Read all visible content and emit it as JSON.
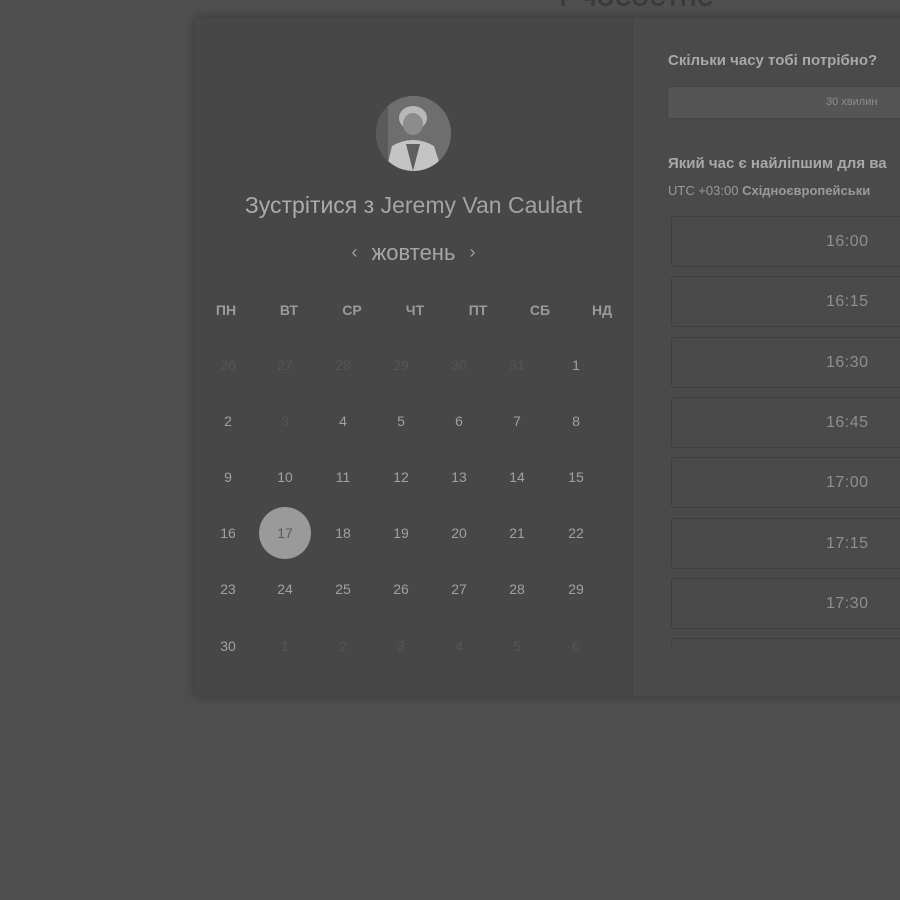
{
  "page": {
    "top_title": "Г ЧОСОСТНС"
  },
  "host": {
    "prefix": "Зустрітися з",
    "name": "Jeremy Van Caulart"
  },
  "calendar": {
    "month": "жовтень",
    "prev_icon": "chevron-left-icon",
    "next_icon": "chevron-right-icon",
    "weekdays": [
      "ПН",
      "ВТ",
      "СР",
      "ЧТ",
      "ПТ",
      "СБ",
      "НД"
    ],
    "weeks": [
      [
        {
          "d": "26",
          "muted": true
        },
        {
          "d": "27",
          "muted": true
        },
        {
          "d": "28",
          "muted": true
        },
        {
          "d": "29",
          "muted": true
        },
        {
          "d": "30",
          "muted": true
        },
        {
          "d": "31",
          "muted": true
        },
        {
          "d": "1",
          "muted": false
        }
      ],
      [
        {
          "d": "2",
          "muted": false
        },
        {
          "d": "3",
          "muted": true
        },
        {
          "d": "4",
          "muted": false
        },
        {
          "d": "5",
          "muted": false
        },
        {
          "d": "6",
          "muted": false
        },
        {
          "d": "7",
          "muted": false
        },
        {
          "d": "8",
          "muted": false
        }
      ],
      [
        {
          "d": "9",
          "muted": false
        },
        {
          "d": "10",
          "muted": false
        },
        {
          "d": "11",
          "muted": false
        },
        {
          "d": "12",
          "muted": false
        },
        {
          "d": "13",
          "muted": false
        },
        {
          "d": "14",
          "muted": false
        },
        {
          "d": "15",
          "muted": false
        }
      ],
      [
        {
          "d": "16",
          "muted": false
        },
        {
          "d": "17",
          "muted": false,
          "selected": true
        },
        {
          "d": "18",
          "muted": false
        },
        {
          "d": "19",
          "muted": false
        },
        {
          "d": "20",
          "muted": false
        },
        {
          "d": "21",
          "muted": false
        },
        {
          "d": "22",
          "muted": false
        }
      ],
      [
        {
          "d": "23",
          "muted": false
        },
        {
          "d": "24",
          "muted": false
        },
        {
          "d": "25",
          "muted": false
        },
        {
          "d": "26",
          "muted": false
        },
        {
          "d": "27",
          "muted": false
        },
        {
          "d": "28",
          "muted": false
        },
        {
          "d": "29",
          "muted": false
        }
      ],
      [
        {
          "d": "30",
          "muted": false
        },
        {
          "d": "1",
          "muted": true
        },
        {
          "d": "2",
          "muted": true
        },
        {
          "d": "3",
          "muted": true
        },
        {
          "d": "4",
          "muted": true
        },
        {
          "d": "5",
          "muted": true
        },
        {
          "d": "6",
          "muted": true
        }
      ]
    ]
  },
  "booking": {
    "duration_question": "Скільки часу тобі потрібно?",
    "duration_value": "30 хвилин",
    "time_question": "Який час є найліпшим для ва",
    "tz_offset": "UTC +03:00",
    "tz_name": "Східноєвропейськи",
    "slots": [
      "16:00",
      "16:15",
      "16:30",
      "16:45",
      "17:00",
      "17:15",
      "17:30",
      ""
    ]
  }
}
